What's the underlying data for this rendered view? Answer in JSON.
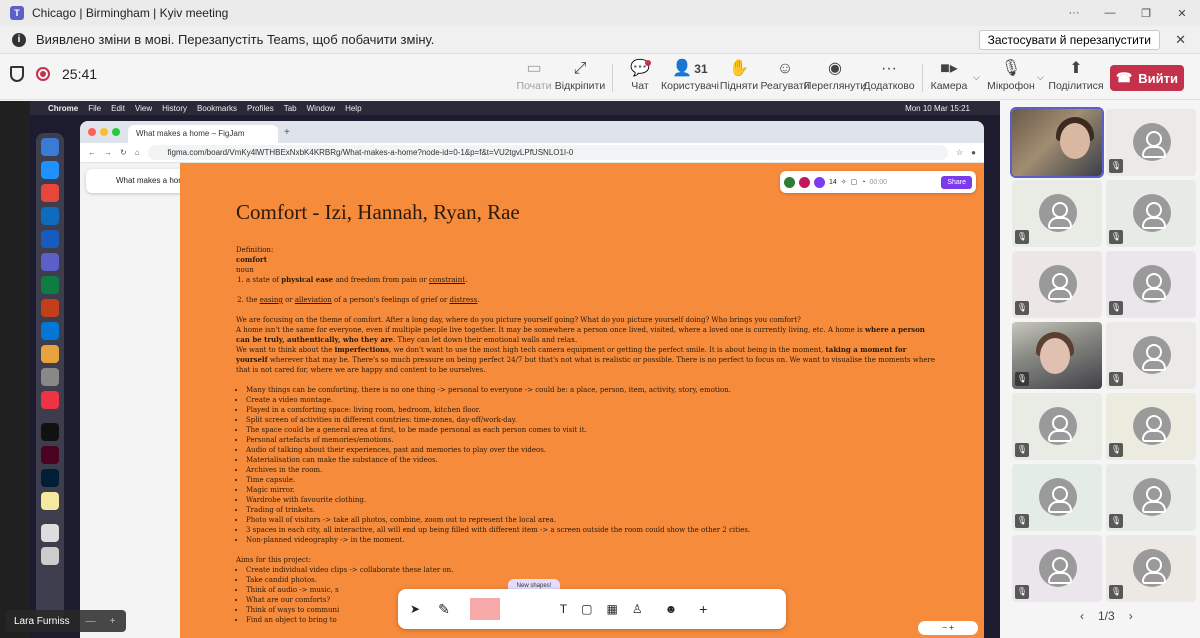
{
  "window": {
    "title": "Chicago | Birmingham | Kyiv meeting"
  },
  "banner": {
    "message": "Виявлено зміни в мові. Перезапустіть Teams, щоб побачити зміну.",
    "apply_label": "Застосувати й перезапустити"
  },
  "toolbar": {
    "timer": "25:41",
    "start_label": "Почати",
    "unpin_label": "Відкріпити",
    "chat_label": "Чат",
    "people_count": "31",
    "people_label": "Користувачі",
    "raise_label": "Підняти",
    "react_label": "Реагувати",
    "view_label": "Переглянути",
    "more_label": "Додатково",
    "camera_label": "Камера",
    "mic_label": "Мікрофон",
    "share_label": "Поділитися",
    "leave_label": "Вийти"
  },
  "mac": {
    "app": "Chrome",
    "menus": [
      "File",
      "Edit",
      "View",
      "History",
      "Bookmarks",
      "Profiles",
      "Tab",
      "Window",
      "Help"
    ],
    "clock": "Mon 10 Mar  15:21"
  },
  "browser": {
    "tab_title": "What makes a home – FigJam",
    "url": "figma.com/board/VmKy4lWTHBExNxbK4KRBRg/What-makes-a-home?node-id=0-1&p=f&t=VU2tgvLPfUSNLO1I-0"
  },
  "figjam": {
    "file_name": "What makes a home",
    "user_count": "14",
    "timer": "00:00",
    "share_label": "Share",
    "new_shapes_label": "New shapes!",
    "zoom": "− +"
  },
  "doc": {
    "title": "Comfort - Izi, Hannah, Ryan, Rae",
    "def_label": "Definition:",
    "def_word": "comfort",
    "def_pos": "noun",
    "def1_a": "a state of ",
    "def1_b": "physical ease",
    "def1_c": " and freedom from pain or ",
    "def1_d": "constraint",
    "def1_e": ".",
    "def2_a": "the ",
    "def2_b": "easing",
    "def2_c": " or ",
    "def2_d": "alleviation",
    "def2_e": " of a person's feelings of grief or ",
    "def2_f": "distress",
    "def2_g": ".",
    "p1": "We are focusing on the theme of comfort. After a long day, where do you picture yourself going? What do you picture yourself doing? Who brings you comfort?",
    "p2_a": "A home isn't the same for everyone, even if  multiple people live together. It may be somewhere a person once lived, visited, where a loved one is currently living, etc. A home is ",
    "p2_b": "where a person can be truly, authentically, who they are",
    "p2_c": ". They can let down their emotional walls and relax.",
    "p3_a": "We want to think about the ",
    "p3_b": "imperfections",
    "p3_c": ", we don't want to use the most high tech camera equipment or getting the perfect smile. It is about being in the moment, ",
    "p3_d": "taking a moment for yourself",
    "p3_e": " wherever that may be. There's so much pressure on being perfect 24/7 but that's not what is realistic or possible. There is no perfect to focus on. We want to visualise the moments where that is not cared for, where we are happy and content to be ourselves.",
    "ideas": [
      "Many things can be comforting, there is no one thing -> personal to everyone ->  could be: a place, person, item, activity, story, emotion.",
      "Create a video montage.",
      "Played in a comforting space: living room, bedroom, kitchen floor.",
      "Split screen of activities in different countries: time-zones, day-off/work-day.",
      "The space could be a general area at first, to be made personal as each person comes to visit it.",
      "Personal artefacts of memories/emotions.",
      "Audio of talking about their experiences, past and memories to play over the videos.",
      "Materialisation can make the substance of the videos.",
      "Archives in the room.",
      "Time capsule.",
      "Magic mirror.",
      "Wardrobe with favourite clothing.",
      "Trading of trinkets.",
      "Photo wall of visitors -> take all photos, combine, zoom out to represent the local area.",
      "3 spaces in each city, all interactive, all will end up being filled with different item -> a screen outside the room could show the other 2 cities.",
      "Non-planned videography -> in the moment."
    ],
    "aims_label": "Aims for this project:",
    "aims": [
      "Create individual video clips -> collaborate these later on.",
      "Take candid photos.",
      "Think of audio -> music, s",
      "What are our comforts?",
      "Think of ways to communi",
      "Find an object to bring to"
    ]
  },
  "self_view": {
    "name": "Lara Furniss"
  },
  "pager": {
    "label": "1/3"
  },
  "colors": {
    "teams_accent": "#5b5fc7",
    "leave": "#c4314b",
    "figjam_orange": "#f68b3c"
  }
}
